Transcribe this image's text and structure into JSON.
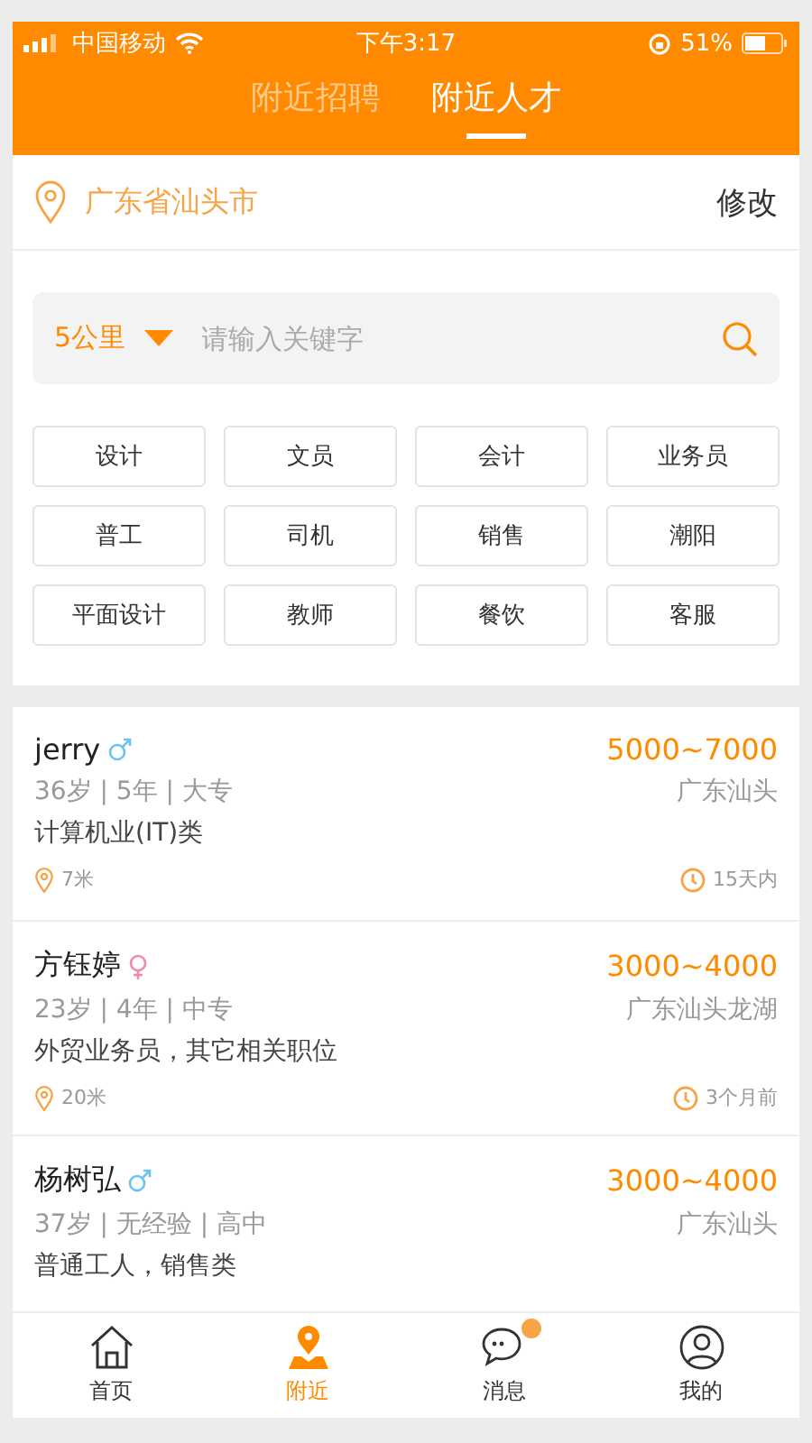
{
  "status_bar": {
    "carrier": "中国移动",
    "time": "下午3:17",
    "battery": "51%"
  },
  "tabs": [
    {
      "label": "附近招聘",
      "selected": false
    },
    {
      "label": "附近人才",
      "selected": true
    }
  ],
  "location": {
    "city": "广东省汕头市",
    "action": "修改"
  },
  "search": {
    "distance": "5公里",
    "placeholder": "请输入关键字"
  },
  "tags": [
    "设计",
    "文员",
    "会计",
    "业务员",
    "普工",
    "司机",
    "销售",
    "潮阳",
    "平面设计",
    "教师",
    "餐饮",
    "客服"
  ],
  "people": [
    {
      "name": "jerry",
      "kind": "male",
      "salary": "5000~7000",
      "info": "36岁 | 5年 | 大专",
      "area": "广东汕头",
      "job": "计算机业(IT)类",
      "distance": "7米",
      "time": "15天内"
    },
    {
      "name": "方钰婷",
      "kind": "female",
      "salary": "3000~4000",
      "info": "23岁 | 4年 | 中专",
      "area": "广东汕头龙湖",
      "job": "外贸业务员，其它相关职位",
      "distance": "20米",
      "time": "3个月前"
    },
    {
      "name": "杨树弘",
      "kind": "male",
      "salary": "3000~4000",
      "info": "37岁 | 无经验 | 高中",
      "area": "广东汕头",
      "job": "普通工人，销售类"
    }
  ],
  "nav": [
    {
      "label": "首页",
      "kind": "home",
      "selected": false
    },
    {
      "label": "附近",
      "kind": "pin",
      "selected": true
    },
    {
      "label": "消息",
      "kind": "chat",
      "selected": false,
      "badge": true
    },
    {
      "label": "我的",
      "kind": "user",
      "selected": false
    }
  ]
}
